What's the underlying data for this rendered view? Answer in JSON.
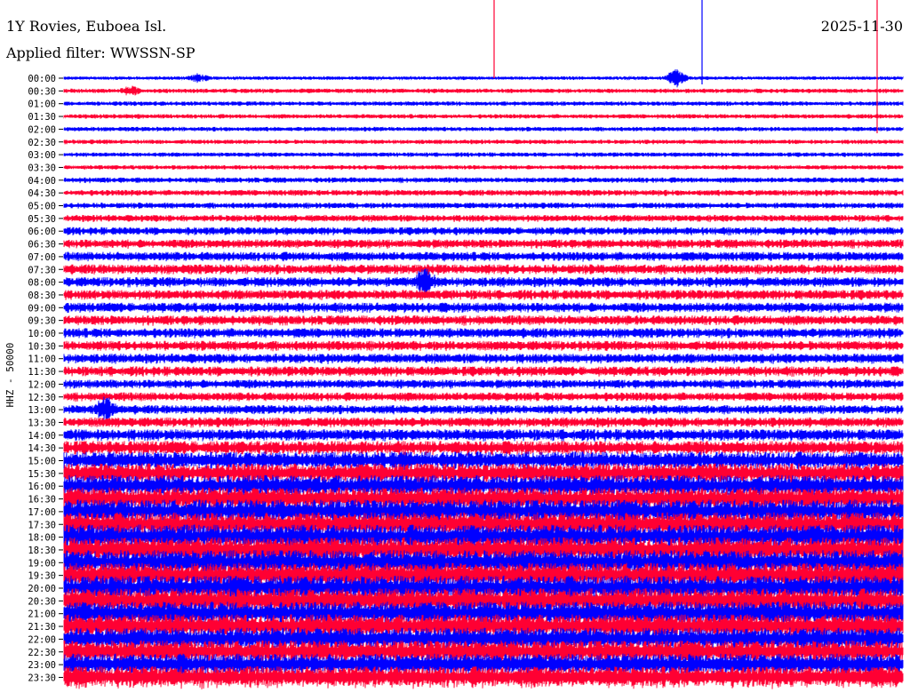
{
  "header": {
    "station": "1Y Rovies, Euboea Isl.",
    "filter": "Applied filter: WWSSN-SP",
    "date": "2025-11-30"
  },
  "chart_data": {
    "type": "line",
    "title": "1Y Rovies, Euboea Isl.",
    "subtitle": "Applied filter: WWSSN-SP",
    "date": "2025-11-30",
    "ylabel": "HHZ - 50000",
    "xlabel": "",
    "row_labels": [
      "00:00",
      "00:30",
      "01:00",
      "01:30",
      "02:00",
      "02:30",
      "03:00",
      "03:30",
      "04:00",
      "04:30",
      "05:00",
      "05:30",
      "06:00",
      "06:30",
      "07:00",
      "07:30",
      "08:00",
      "08:30",
      "09:00",
      "09:30",
      "10:00",
      "10:30",
      "11:00",
      "11:30",
      "12:00",
      "12:30",
      "13:00",
      "13:30",
      "14:00",
      "14:30",
      "15:00",
      "15:30",
      "16:00",
      "16:30",
      "17:00",
      "17:30",
      "18:00",
      "18:30",
      "19:00",
      "19:30",
      "20:00",
      "20:30",
      "21:00",
      "21:30",
      "22:00",
      "22:30",
      "23:00",
      "23:30"
    ],
    "trace_colors": [
      "#0000ff",
      "#ff0033"
    ],
    "relative_amplitude": [
      0.35,
      0.45,
      0.45,
      0.45,
      0.45,
      0.45,
      0.45,
      0.45,
      0.55,
      0.6,
      0.6,
      0.7,
      0.8,
      0.9,
      0.95,
      1.0,
      1.0,
      1.0,
      1.0,
      1.0,
      1.0,
      1.0,
      1.0,
      1.0,
      0.9,
      0.9,
      0.9,
      1.0,
      1.2,
      1.4,
      1.8,
      2.0,
      2.2,
      2.3,
      2.4,
      2.4,
      2.5,
      2.5,
      2.5,
      2.5,
      2.5,
      2.5,
      2.4,
      2.4,
      2.3,
      2.3,
      2.2,
      2.2
    ],
    "events": [
      {
        "row": 0,
        "position": 0.73,
        "amplitude": 5.0
      },
      {
        "row": 0,
        "position": 0.16,
        "amplitude": 2.0
      },
      {
        "row": 1,
        "position": 0.08,
        "amplitude": 1.5
      },
      {
        "row": 16,
        "position": 0.43,
        "amplitude": 2.5
      },
      {
        "row": 26,
        "position": 0.05,
        "amplitude": 2.5
      }
    ],
    "grid": false
  }
}
